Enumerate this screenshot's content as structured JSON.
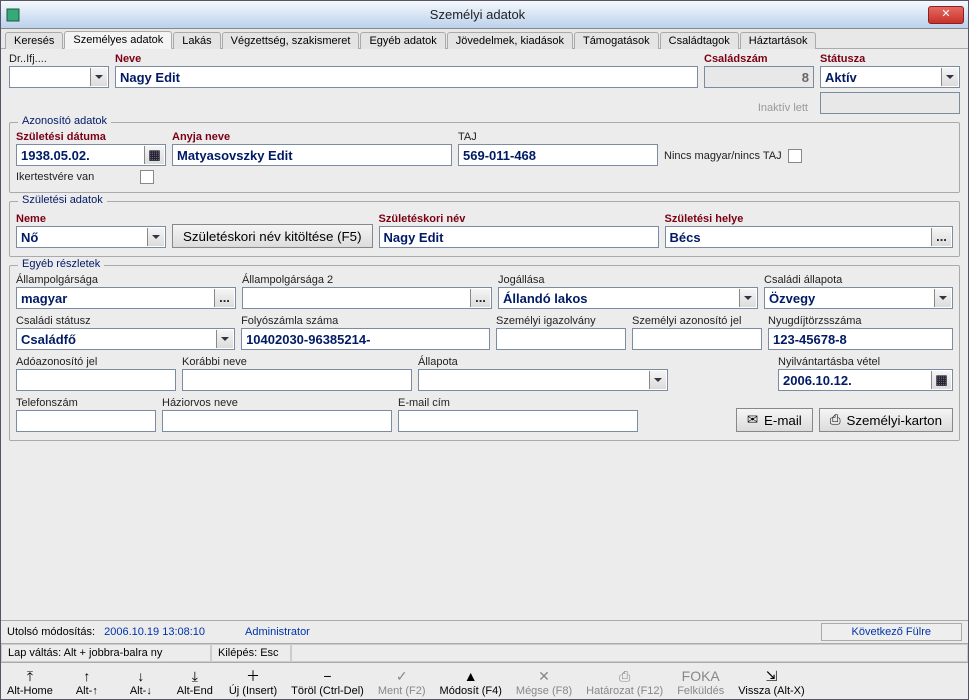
{
  "window_title": "Személyi adatok",
  "tabs": [
    "Keresés",
    "Személyes adatok",
    "Lakás",
    "Végzettség, szakismeret",
    "Egyéb adatok",
    "Jövedelmek, kiadások",
    "Támogatások",
    "Családtagok",
    "Háztartások"
  ],
  "active_tab_index": 1,
  "header": {
    "prefix_label": "Dr..Ifj....",
    "prefix_value": "",
    "name_label": "Neve",
    "name_value": "Nagy Edit",
    "family_num_label": "Családszám",
    "family_num_value": "8",
    "status_label": "Státusza",
    "status_value": "Aktív",
    "inaktiv_label": "Inaktív lett"
  },
  "azonosito": {
    "legend": "Azonosító adatok",
    "birthdate_label": "Születési dátuma",
    "birthdate_value": "1938.05.02.",
    "mother_label": "Anyja neve",
    "mother_value": "Matyasovszky Edit",
    "taj_label": "TAJ",
    "taj_value": "569-011-468",
    "no_taj_label": "Nincs magyar/nincs TAJ",
    "twin_label": "Ikertestvére van"
  },
  "szuletesi": {
    "legend": "Születési adatok",
    "neme_label": "Neme",
    "neme_value": "Nő",
    "fill_btn": "Születéskori név kitöltése (F5)",
    "birthname_label": "Születéskori név",
    "birthname_value": "Nagy Edit",
    "birthplace_label": "Születési helye",
    "birthplace_value": "Bécs"
  },
  "egyeb": {
    "legend": "Egyéb részletek",
    "citizenship_label": "Állampolgársága",
    "citizenship_value": "magyar",
    "citizenship2_label": "Állampolgársága 2",
    "citizenship2_value": "",
    "jogallas_label": "Jogállása",
    "jogallas_value": "Állandó lakos",
    "marital_label": "Családi állapota",
    "marital_value": "Özvegy",
    "family_status_label": "Családi státusz",
    "family_status_value": "Családfő",
    "account_label": "Folyószámla száma",
    "account_value": "10402030-96385214-",
    "idcard_label": "Személyi igazolvány",
    "idcard_value": "",
    "personid_label": "Személyi azonosító jel",
    "personid_value": "",
    "pension_label": "Nyugdíjtörzsszáma",
    "pension_value": "123-45678-8",
    "taxid_label": "Adóazonosító jel",
    "taxid_value": "",
    "prevname_label": "Korábbi neve",
    "prevname_value": "",
    "allapot_label": "Állapota",
    "allapot_value": "",
    "registered_label": "Nyilvántartásba vétel",
    "registered_value": "2006.10.12.",
    "phone_label": "Telefonszám",
    "phone_value": "",
    "doctor_label": "Háziorvos neve",
    "doctor_value": "",
    "email_label": "E-mail cím",
    "email_value": "",
    "email_btn": "E-mail",
    "card_btn": "Személyi-karton"
  },
  "footer": {
    "lastmod_label": "Utolsó módosítás:",
    "lastmod_value": "2006.10.19 13:08:10",
    "user": "Administrator",
    "next_btn": "Következő Fülre",
    "hint_lap": "Lap váltás: Alt + jobbra-balra ny",
    "hint_exit": "Kilépés: Esc"
  },
  "toolbar": [
    {
      "label": "Alt-Home",
      "icon": "⤒",
      "interactable": true
    },
    {
      "label": "Alt-↑",
      "icon": "↑",
      "interactable": true
    },
    {
      "label": "Alt-↓",
      "icon": "↓",
      "interactable": true
    },
    {
      "label": "Alt-End",
      "icon": "⤓",
      "interactable": true
    },
    {
      "label": "Új (Insert)",
      "icon": "＋",
      "interactable": true
    },
    {
      "label": "Töröl (Ctrl-Del)",
      "icon": "−",
      "interactable": true
    },
    {
      "label": "Ment (F2)",
      "icon": "✓",
      "interactable": false
    },
    {
      "label": "Módosít (F4)",
      "icon": "▲",
      "interactable": true
    },
    {
      "label": "Mégse (F8)",
      "icon": "✕",
      "interactable": false
    },
    {
      "label": "Határozat (F12)",
      "icon": "⎙",
      "interactable": false
    },
    {
      "label": "Felküldés",
      "icon": "FOKA",
      "interactable": false
    },
    {
      "label": "Vissza (Alt-X)",
      "icon": "⇲",
      "interactable": true
    }
  ]
}
